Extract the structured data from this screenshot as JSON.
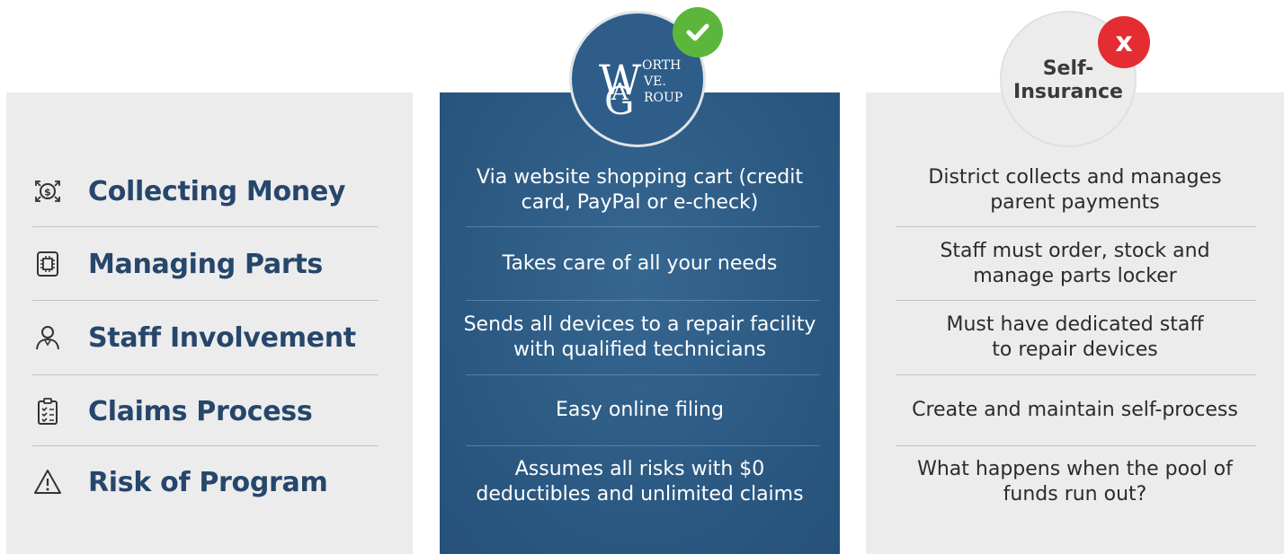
{
  "colors": {
    "panel_gray": "#ececed",
    "panel_blue": "#2e5e88",
    "label_navy": "#26466b",
    "check_green": "#5cb63b",
    "x_red": "#e42c33"
  },
  "features": [
    {
      "label": "Collecting Money",
      "icon": "money-exchange-icon"
    },
    {
      "label": "Managing Parts",
      "icon": "circuit-chip-icon"
    },
    {
      "label": "Staff Involvement",
      "icon": "person-icon"
    },
    {
      "label": "Claims Process",
      "icon": "clipboard-checklist-icon"
    },
    {
      "label": "Risk of Program",
      "icon": "warning-triangle-icon"
    }
  ],
  "worth_ave": {
    "logo": {
      "letter_w": "W",
      "letter_a": "A",
      "letter_g": "G",
      "line1": "ORTH",
      "line2": "VE.",
      "line3": "ROUP"
    },
    "badge_icon": "checkmark-icon",
    "items": [
      "Via website shopping cart (credit\ncard, PayPal or e-check)",
      "Takes care of all your needs",
      "Sends all devices to a repair facility\nwith qualified technicians",
      "Easy online filing",
      "Assumes all risks with $0\ndeductibles and unlimited claims"
    ]
  },
  "self_insurance": {
    "title": "Self-\nInsurance",
    "badge": "x",
    "items": [
      "District collects and manages\nparent payments",
      "Staff must order, stock and\nmanage parts locker",
      "Must have dedicated staff\nto repair devices",
      "Create and maintain self-process",
      "What happens when the pool of\nfunds run out?"
    ]
  }
}
